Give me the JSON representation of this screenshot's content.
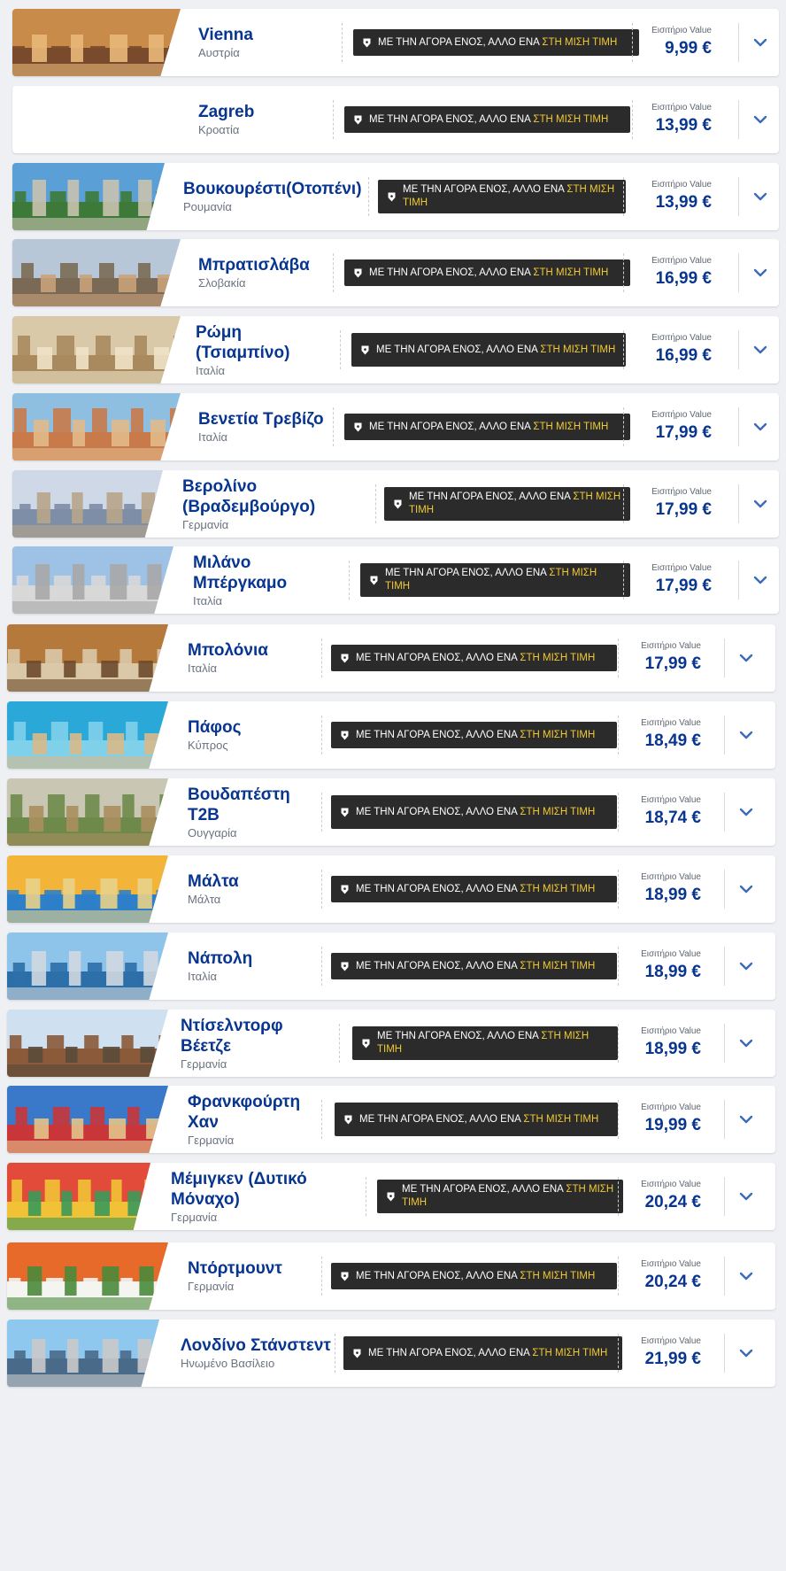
{
  "promo": {
    "text_prefix": "ΜΕ ΤΗΝ ΑΓΟΡΑ ΕΝΟΣ, ΑΛΛΟ ΕΝΑ",
    "text_highlight": "ΣΤΗ ΜΙΣΗ ΤΙΜΗ",
    "icon": "shield-tag-icon",
    "highlight_color": "#f1c933"
  },
  "fare_label": "Εισιτήριο Value",
  "expand_icon": "chevron-down-icon",
  "colors": {
    "brand": "#073590",
    "chevron": "#3d6bb8",
    "card": "#ffffff",
    "background": "#eef0f3"
  },
  "destinations": [
    {
      "city": "Vienna",
      "country": "Αυστρία",
      "price": "9,99 €"
    },
    {
      "city": "Zagreb",
      "country": "Κροατία",
      "price": "13,99 €"
    },
    {
      "city": "Βουκουρέστι(Οτοπένι)",
      "country": "Ρουμανία",
      "price": "13,99 €"
    },
    {
      "city": "Μπρατισλάβα",
      "country": "Σλοβακία",
      "price": "16,99 €"
    },
    {
      "city": "Ρώμη (Τσιαμπίνο)",
      "country": "Ιταλία",
      "price": "16,99 €"
    },
    {
      "city": "Βενετία Τρεβίζο",
      "country": "Ιταλία",
      "price": "17,99 €"
    },
    {
      "city": "Βερολίνο (Βραδεμβούργο)",
      "country": "Γερμανία",
      "price": "17,99 €"
    },
    {
      "city": "Μιλάνο Μπέργκαμο",
      "country": "Ιταλία",
      "price": "17,99 €"
    },
    {
      "city": "Μπολόνια",
      "country": "Ιταλία",
      "price": "17,99 €"
    },
    {
      "city": "Πάφος",
      "country": "Κύπρος",
      "price": "18,49 €"
    },
    {
      "city": "Βουδαπέστη T2B",
      "country": "Ουγγαρία",
      "price": "18,74 €"
    },
    {
      "city": "Μάλτα",
      "country": "Μάλτα",
      "price": "18,99 €"
    },
    {
      "city": "Νάπολη",
      "country": "Ιταλία",
      "price": "18,99 €"
    },
    {
      "city": "Ντίσελντορφ Βέετζε",
      "country": "Γερμανία",
      "price": "18,99 €"
    },
    {
      "city": "Φρανκφούρτη Χαν",
      "country": "Γερμανία",
      "price": "19,99 €"
    },
    {
      "city": "Μέμιγκεν (Δυτικό Μόναχο)",
      "country": "Γερμανία",
      "price": "20,24 €"
    },
    {
      "city": "Ντόρτμουντ",
      "country": "Γερμανία",
      "price": "20,24 €"
    },
    {
      "city": "Λονδίνο Στάνστεντ",
      "country": "Ηνωμένο Βασίλειο",
      "price": "21,99 €"
    }
  ]
}
